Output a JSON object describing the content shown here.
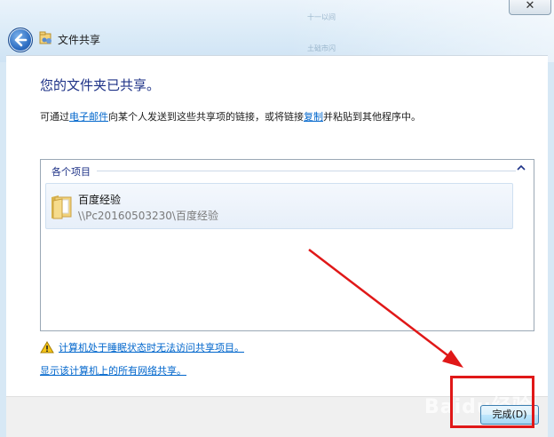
{
  "window": {
    "title": "文件共享",
    "close_glyph": "✕",
    "background_items": [
      "十一以间",
      "土础市闪"
    ]
  },
  "content": {
    "heading": "您的文件夹已共享。",
    "desc_prefix": "可通过",
    "email_link": "电子邮件",
    "desc_middle": "向某个人发送到这些共享项的链接，或将链接",
    "copy_link": "复制",
    "desc_suffix": "并粘贴到其他程序中。"
  },
  "list": {
    "group_label": "各个项目",
    "items": [
      {
        "name": "百度经验",
        "path": "\\\\Pc20160503230\\百度经验"
      }
    ]
  },
  "links": {
    "warning": "计算机处于睡眠状态时无法访问共享项目。",
    "show_all": "显示该计算机上的所有网络共享。"
  },
  "footer": {
    "finish_label": "完成(D)"
  },
  "annotation": {
    "color": "#e01818",
    "watermark": "Baidu经验"
  }
}
